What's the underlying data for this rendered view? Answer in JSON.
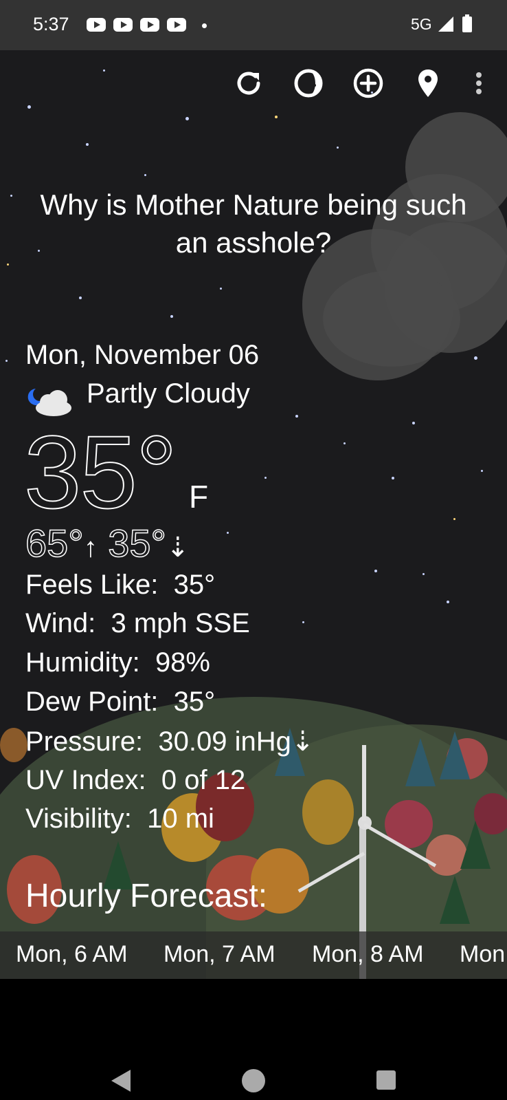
{
  "status_bar": {
    "time": "5:37",
    "network": "5G",
    "notification_icons": [
      "youtube-icon",
      "youtube-icon",
      "youtube-icon",
      "youtube-icon"
    ]
  },
  "toolbar": {
    "icons": [
      "refresh-icon",
      "theme-icon",
      "add-location-icon",
      "location-pin-icon",
      "more-options-icon"
    ]
  },
  "headline": "Why is Mother Nature being such an asshole?",
  "current": {
    "date": "Mon, November 06",
    "condition": "Partly Cloudy",
    "condition_icon": "partly-cloudy-night-icon",
    "temperature": "35°",
    "unit": "F",
    "high": "65°",
    "low": "35°",
    "high_arrow": "↑",
    "low_arrow": "⇣"
  },
  "details": [
    {
      "label": "Feels Like:",
      "value": "35°"
    },
    {
      "label": "Wind:",
      "value": "3 mph SSE"
    },
    {
      "label": "Humidity:",
      "value": "98%"
    },
    {
      "label": "Dew Point:",
      "value": "35°"
    },
    {
      "label": "Pressure:",
      "value": "30.09 inHg⇣"
    },
    {
      "label": "UV Index:",
      "value": "0 of 12"
    },
    {
      "label": "Visibility:",
      "value": "10 mi"
    }
  ],
  "hourly": {
    "title": "Hourly Forecast:",
    "items": [
      "Mon, 6 AM",
      "Mon, 7 AM",
      "Mon, 8 AM",
      "Mon"
    ]
  }
}
